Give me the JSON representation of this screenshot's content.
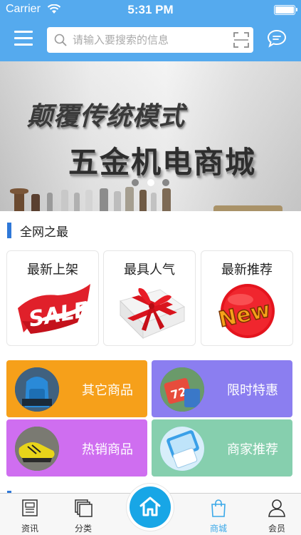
{
  "status_bar": {
    "carrier": "Carrier",
    "time": "5:31 PM"
  },
  "header": {
    "menu_icon": "hamburger-menu-icon",
    "search": {
      "placeholder": "请输入要搜索的信息",
      "value": ""
    },
    "scan_icon": "scan-icon",
    "chat_icon": "chat-bubble-icon"
  },
  "banner": {
    "line1": "颠覆传统模式",
    "line2": "五金机电商城",
    "slide_count": 3,
    "active_slide": 2
  },
  "section": {
    "title": "全网之最",
    "features": [
      {
        "label": "最新上架",
        "icon": "sale-icon"
      },
      {
        "label": "最具人气",
        "icon": "gift-icon"
      },
      {
        "label": "最新推荐",
        "icon": "new-badge-icon"
      }
    ],
    "tiles": [
      {
        "label": "其它商品",
        "color": "#f6a01a",
        "icon": "backpack-thumbnail"
      },
      {
        "label": "限时特惠",
        "color": "#8b7ef0",
        "icon": "sale-thumbnail"
      },
      {
        "label": "热销商品",
        "color": "#cf6ef0",
        "icon": "shoe-thumbnail"
      },
      {
        "label": "商家推荐",
        "color": "#86cfae",
        "icon": "phone-thumbnail"
      }
    ]
  },
  "tab_bar": {
    "tabs": [
      {
        "label": "资讯",
        "icon": "news-icon",
        "active": false
      },
      {
        "label": "分类",
        "icon": "category-icon",
        "active": false
      },
      {
        "label": "商城",
        "icon": "shopping-bag-icon",
        "active": true
      },
      {
        "label": "会员",
        "icon": "user-icon",
        "active": false
      }
    ],
    "center": {
      "icon": "home-icon"
    }
  },
  "colors": {
    "primary": "#55aaee",
    "accent": "#2f78d8",
    "tab_active": "#3aa8e8",
    "home_button": "#18a6e6"
  }
}
